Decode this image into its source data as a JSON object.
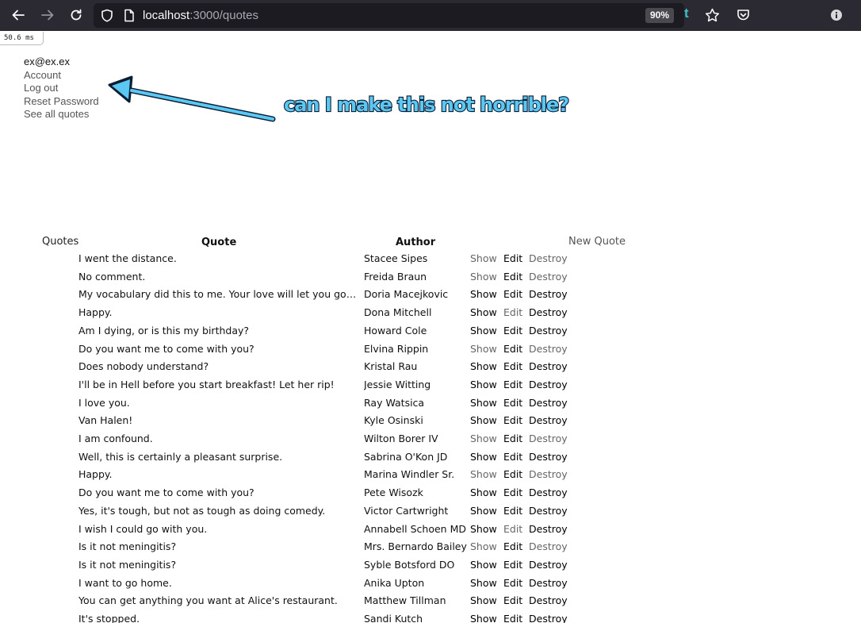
{
  "browser": {
    "url_host": "localhost",
    "url_path": ":3000/quotes",
    "zoom": "90%",
    "toolbar_letter": "t"
  },
  "timing": "50.6 ms",
  "nav": {
    "email": "ex@ex.ex",
    "links": [
      "Account",
      "Log out",
      "Reset Password",
      "See all quotes"
    ]
  },
  "annotation": {
    "text": "can I make this not horrible?",
    "color": "#5ac8f3"
  },
  "quotes": {
    "title": "Quotes",
    "columns": [
      "Quote",
      "Author"
    ],
    "new_label": "New Quote",
    "action_labels": [
      "Show",
      "Edit",
      "Destroy"
    ],
    "rows": [
      {
        "quote": "I went the distance.",
        "author": "Stacee Sipes"
      },
      {
        "quote": "No comment.",
        "author": "Freida Braun"
      },
      {
        "quote": "My vocabulary did this to me. Your love will let you go on...",
        "author": "Doria Macejkovic"
      },
      {
        "quote": "Happy.",
        "author": "Dona Mitchell"
      },
      {
        "quote": "Am I dying, or is this my birthday?",
        "author": "Howard Cole"
      },
      {
        "quote": "Do you want me to come with you?",
        "author": "Elvina Rippin"
      },
      {
        "quote": "Does nobody understand?",
        "author": "Kristal Rau"
      },
      {
        "quote": "I'll be in Hell before you start breakfast! Let her rip!",
        "author": "Jessie Witting"
      },
      {
        "quote": "I love you.",
        "author": "Ray Watsica"
      },
      {
        "quote": "Van Halen!",
        "author": "Kyle Osinski"
      },
      {
        "quote": "I am confound.",
        "author": "Wilton Borer IV"
      },
      {
        "quote": "Well, this is certainly a pleasant surprise.",
        "author": "Sabrina O'Kon JD"
      },
      {
        "quote": "Happy.",
        "author": "Marina Windler Sr."
      },
      {
        "quote": "Do you want me to come with you?",
        "author": "Pete Wisozk"
      },
      {
        "quote": "Yes, it's tough, but not as tough as doing comedy.",
        "author": "Victor Cartwright"
      },
      {
        "quote": "I wish I could go with you.",
        "author": "Annabell Schoen MD"
      },
      {
        "quote": "Is it not meningitis?",
        "author": "Mrs. Bernardo Bailey"
      },
      {
        "quote": "Is it not meningitis?",
        "author": "Syble Botsford DO"
      },
      {
        "quote": "I want to go home.",
        "author": "Anika Upton"
      },
      {
        "quote": "You can get anything you want at Alice's restaurant.",
        "author": "Matthew Tillman"
      },
      {
        "quote": "It's stopped.",
        "author": "Sandi Kutch"
      }
    ]
  }
}
